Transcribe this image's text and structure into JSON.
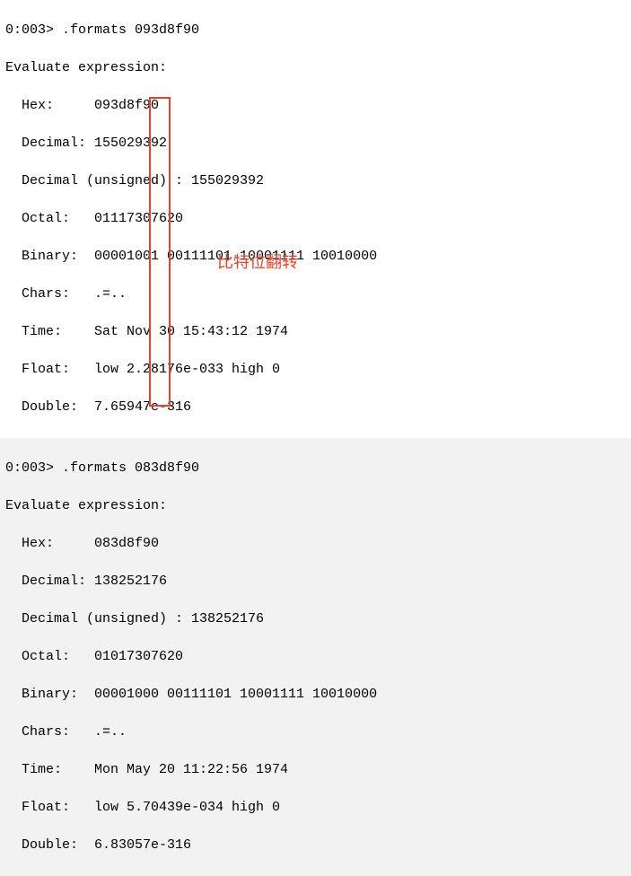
{
  "block1": {
    "prompt": "0:003> .formats 093d8f90",
    "header": "Evaluate expression:",
    "hex": "  Hex:     093d8f90",
    "dec": "  Decimal: 155029392",
    "decu": "  Decimal (unsigned) : 155029392",
    "octal": "  Octal:   01117307620",
    "binary": "  Binary:  00001001 00111101 10001111 10010000",
    "chars": "  Chars:   .=..",
    "time": "  Time:    Sat Nov 30 15:43:12 1974",
    "float": "  Float:   low 2.28176e-033 high 0",
    "double": "  Double:  7.65947e-316"
  },
  "block2": {
    "prompt": "0:003> .formats 083d8f90",
    "header": "Evaluate expression:",
    "hex": "  Hex:     083d8f90",
    "dec": "  Decimal: 138252176",
    "decu": "  Decimal (unsigned) : 138252176",
    "octal": "  Octal:   01017307620",
    "binary": "  Binary:  00001000 00111101 10001111 10010000",
    "chars": "  Chars:   .=..",
    "time": "  Time:    Mon May 20 11:22:56 1974",
    "float": "  Float:   low 5.70439e-034 high 0",
    "double": "  Double:  6.83057e-316"
  },
  "annotation": {
    "label": "比特位翻转"
  },
  "highlight": {
    "color": "#e8402a"
  }
}
